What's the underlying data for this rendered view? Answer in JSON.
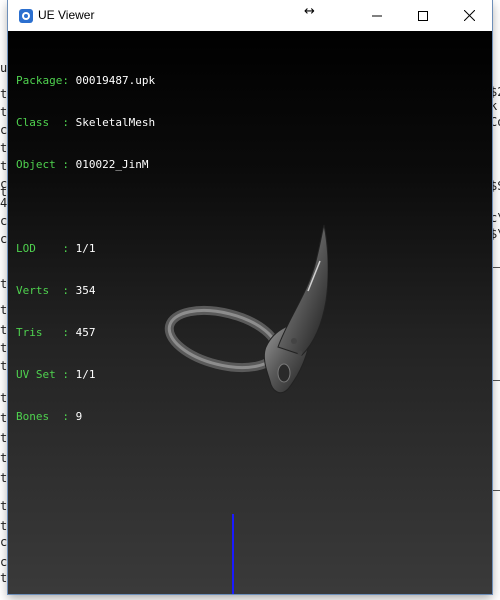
{
  "window": {
    "title": "UE Viewer"
  },
  "titlebar": {
    "icon": "ue-viewer-app-icon",
    "controls": [
      "minimize-icon",
      "maximize-icon",
      "close-icon"
    ]
  },
  "info_panel": {
    "package": {
      "label": "Package:",
      "value": "00019487.upk"
    },
    "class": {
      "label": "Class  :",
      "value": "SkeletalMesh"
    },
    "object": {
      "label": "Object :",
      "value": "010022_JinM"
    },
    "lod": {
      "label": "LOD    :",
      "value": "1/1"
    },
    "verts": {
      "label": "Verts  :",
      "value": "354"
    },
    "tris": {
      "label": "Tris   :",
      "value": "457"
    },
    "uvset": {
      "label": "UV Set :",
      "value": "1/1"
    },
    "bones": {
      "label": "Bones  :",
      "value": "9"
    }
  },
  "background_terminal": {
    "left_chars": [
      "u",
      "t",
      "t",
      "c",
      "t",
      "t",
      "c",
      "t",
      "4",
      "c",
      "c",
      "t",
      "t",
      "t",
      "t",
      "t",
      "t",
      "t",
      "t",
      "t",
      "t",
      "t",
      "t",
      "c",
      "c",
      "t"
    ],
    "right_chars": [
      "$2",
      "k",
      "Co",
      "$S",
      "c\\",
      "$\\"
    ]
  },
  "colors": {
    "label_green": "#4fd24f",
    "value_white": "#ffffff",
    "axis_blue": "#1a1aff"
  }
}
